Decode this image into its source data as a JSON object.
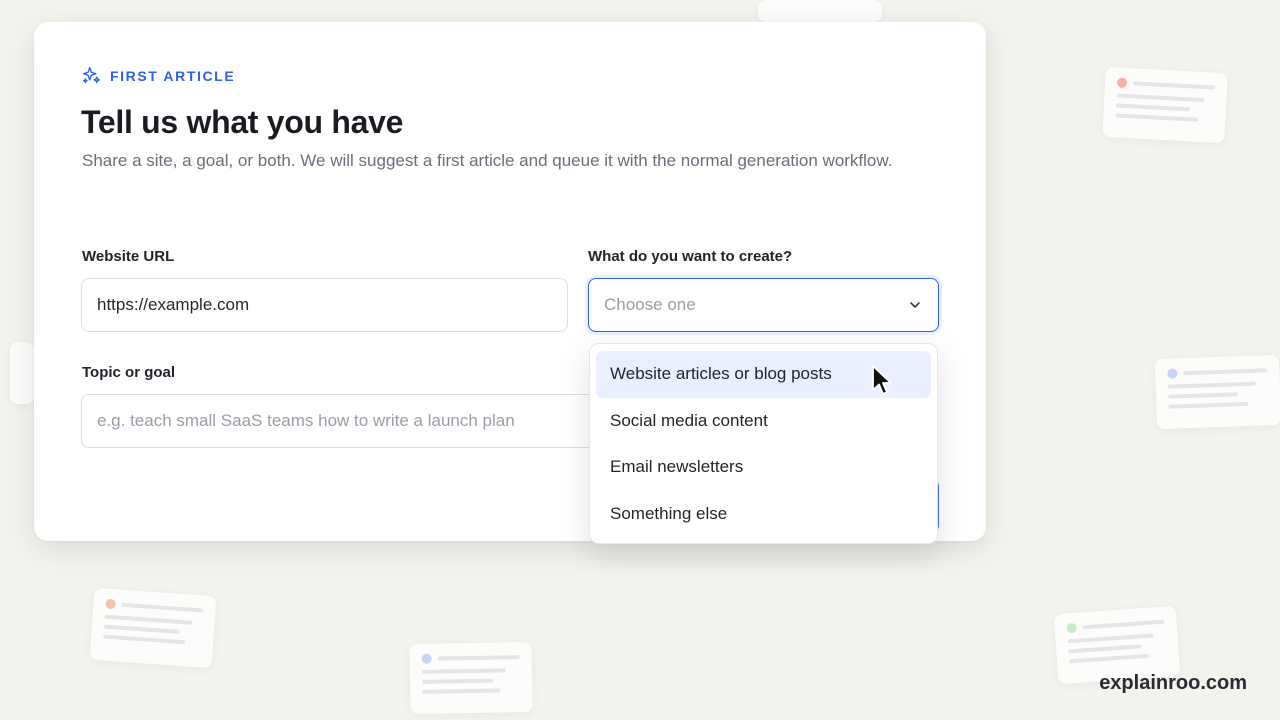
{
  "header": {
    "eyebrow": "FIRST ARTICLE",
    "eyebrow_icon": "sparkles-icon",
    "title": "Tell us what you have",
    "subtitle": "Share a site, a goal, or both. We will suggest a first article and queue it with the normal generation workflow."
  },
  "form": {
    "url_label": "Website URL",
    "url_value": "https://example.com",
    "create_label": "What do you want to create?",
    "create_placeholder": "Choose one",
    "topic_label": "Topic or goal",
    "topic_placeholder": "e.g. teach small SaaS teams how to write a launch plan"
  },
  "dropdown": {
    "items": [
      {
        "label": "Website articles or blog posts",
        "highlighted": true
      },
      {
        "label": "Social media content",
        "highlighted": false
      },
      {
        "label": "Email newsletters",
        "highlighted": false
      },
      {
        "label": "Something else",
        "highlighted": false
      }
    ]
  },
  "brand": {
    "watermark": "explainroo.com"
  },
  "colors": {
    "accent": "#2f62e6",
    "highlight": "#e9efff",
    "background": "#f3f2ed"
  }
}
